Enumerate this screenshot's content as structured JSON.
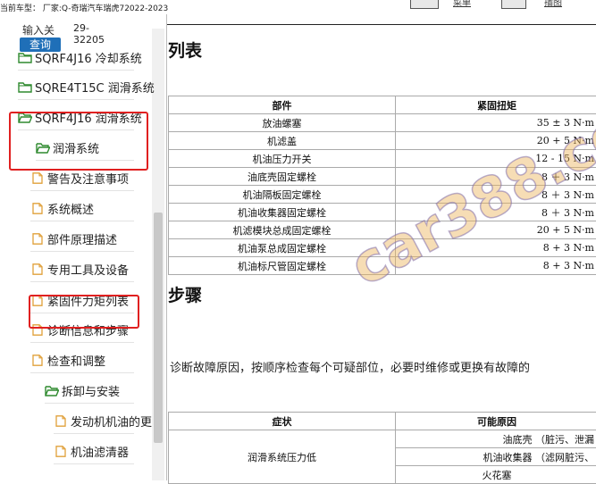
{
  "topbar": {
    "vehicle_info": "当前车型： 厂家:Q-奇瑞汽车瑞虎72022-2023",
    "btn_menu": "菜单",
    "btn_illustration": "插图"
  },
  "sidebar": {
    "search_label": "输入关",
    "search_value": "29-32205",
    "search_button": "查询",
    "items": [
      {
        "label": "SQRF4J16 冷却系统",
        "type": "folder"
      },
      {
        "label": "SQRE4T15C 润滑系统",
        "type": "folder"
      },
      {
        "label": "SQRF4J16 润滑系统",
        "type": "folder-open"
      },
      {
        "label": "润滑系统",
        "type": "folder-open"
      },
      {
        "label": "警告及注意事项",
        "type": "doc"
      },
      {
        "label": "系统概述",
        "type": "doc"
      },
      {
        "label": "部件原理描述",
        "type": "doc"
      },
      {
        "label": "专用工具及设备",
        "type": "doc"
      },
      {
        "label": "紧固件力矩列表",
        "type": "doc"
      },
      {
        "label": "诊断信息和步骤",
        "type": "doc"
      },
      {
        "label": "检查和调整",
        "type": "doc"
      },
      {
        "label": "拆卸与安装",
        "type": "folder-open"
      },
      {
        "label": "发动机机油的更",
        "type": "doc"
      },
      {
        "label": "机油滤清器",
        "type": "doc"
      }
    ]
  },
  "doc": {
    "heading1": "列表",
    "table1": {
      "headers": [
        "部件",
        "紧固扭矩"
      ],
      "rows": [
        [
          "放油螺塞",
          "35 ± 3 N·m"
        ],
        [
          "机滤盖",
          "20 + 5 N·m"
        ],
        [
          "机油压力开关",
          "12 - 15 N·m"
        ],
        [
          "油底壳固定螺栓",
          "8 ＋ 3 N·m"
        ],
        [
          "机油隔板固定螺栓",
          "8 ＋ 3 N·m"
        ],
        [
          "机油收集器固定螺栓",
          "8 ＋ 3 N·m"
        ],
        [
          "机滤模块总成固定螺栓",
          "20 + 5 N·m"
        ],
        [
          "机油泵总成固定螺栓",
          "8 + 3 N·m"
        ],
        [
          "机油标尺管固定螺栓",
          "8 + 3 N·m"
        ]
      ]
    },
    "heading2": "步骤",
    "paragraph": "诊断故障原因，按顺序检查每个可疑部位，必要时维修或更换有故障的",
    "table2": {
      "headers": [
        "症状",
        "可能原因"
      ],
      "symptom": "润滑系统压力低",
      "causes": [
        "油底壳 （脏污、泄漏",
        "机油收集器 （滤网脏污、",
        "火花塞"
      ]
    },
    "watermark": "car388.com"
  }
}
